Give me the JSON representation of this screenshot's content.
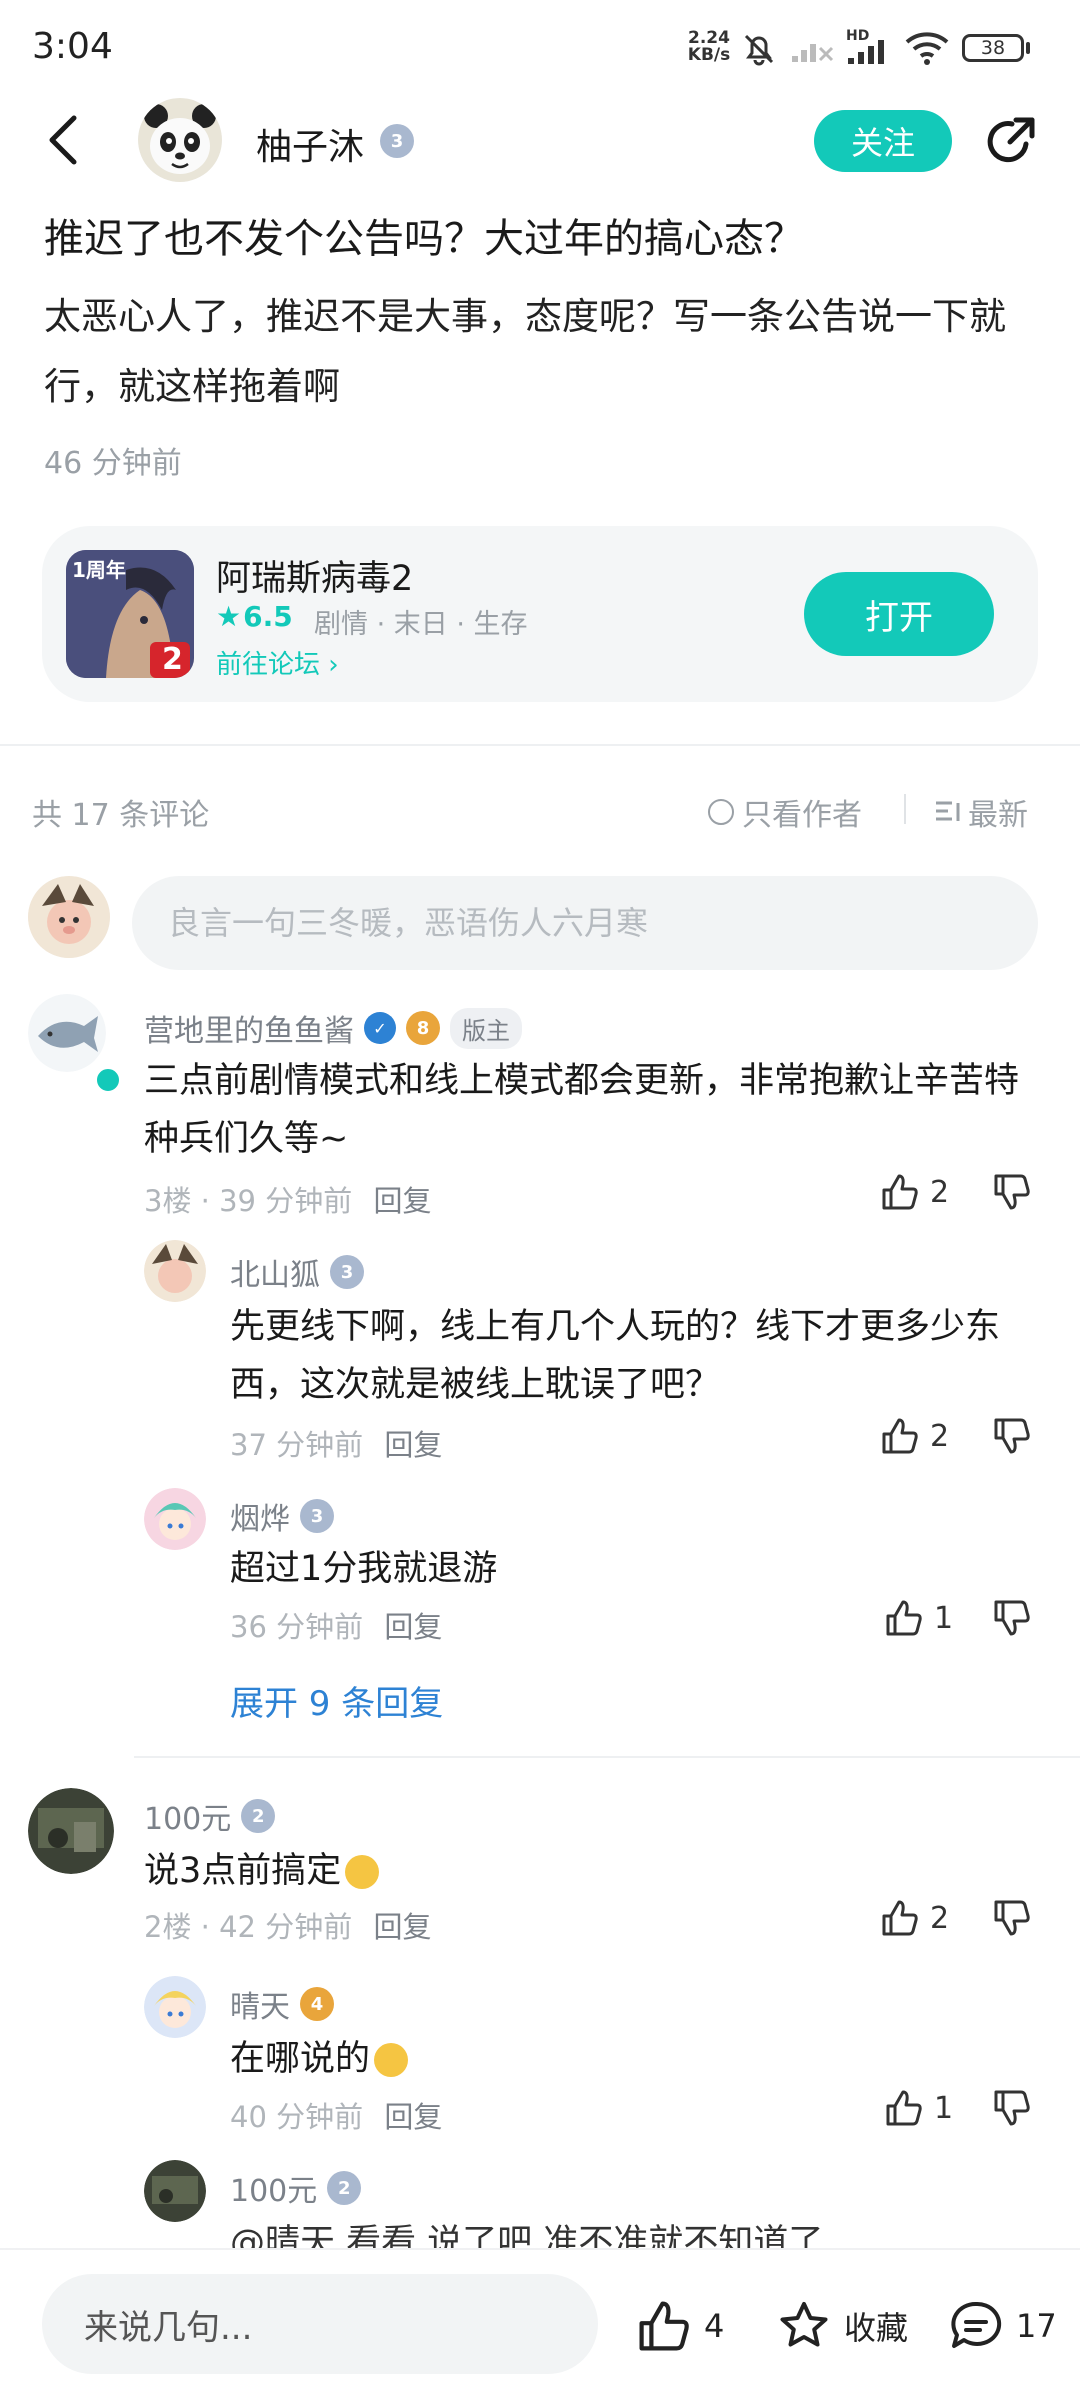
{
  "status_bar": {
    "time": "3:04",
    "net_speed_top": "2.24",
    "net_speed_bottom": "KB/s",
    "battery": "38",
    "hd": "HD"
  },
  "header": {
    "author": "柚子沐",
    "author_level": "3",
    "follow_label": "关注"
  },
  "post": {
    "title": "推迟了也不发个公告吗？大过年的搞心态？",
    "body": "太恶心人了，推迟不是大事，态度呢？写一条公告说一下就行，就这样拖着啊",
    "time": "46 分钟前"
  },
  "game_card": {
    "name": "阿瑞斯病毒2",
    "score": "6.5",
    "tags": "剧情 · 末日 · 生存",
    "forum_link": "前往论坛",
    "open_label": "打开",
    "icon_text": "1周年",
    "icon_num": "2"
  },
  "comments_header": {
    "count": "共 17 条评论",
    "only_author": "只看作者",
    "sort": "最新"
  },
  "comment_input": {
    "placeholder": "良言一句三冬暖，恶语伤人六月寒"
  },
  "comments": [
    {
      "user": "营地里的鱼鱼酱",
      "level": "8",
      "badge": "版主",
      "text": "三点前剧情模式和线上模式都会更新，非常抱歉让辛苦特种兵们久等~",
      "floor": "3楼",
      "time": "39 分钟前",
      "reply": "回复",
      "likes": "2",
      "replies": [
        {
          "user": "北山狐",
          "level": "3",
          "text": "先更线下啊，线上有几个人玩的？线下才更多少东西，这次就是被线上耽误了吧？",
          "time": "37 分钟前",
          "reply": "回复",
          "likes": "2"
        },
        {
          "user": "烟烨",
          "level": "3",
          "text": "超过1分我就退游",
          "time": "36 分钟前",
          "reply": "回复",
          "likes": "1"
        }
      ],
      "expand": "展开 9 条回复"
    },
    {
      "user": "100元",
      "level": "2",
      "text": "说3点前搞定",
      "floor": "2楼",
      "time": "42 分钟前",
      "reply": "回复",
      "likes": "2",
      "replies": [
        {
          "user": "晴天",
          "level": "4",
          "text": "在哪说的",
          "time": "40 分钟前",
          "reply": "回复",
          "likes": "1"
        },
        {
          "user": "100元",
          "level": "2",
          "text": "@晴天  看看 说了吧 准不准就不知道了"
        }
      ]
    }
  ],
  "bottom_bar": {
    "input_label": "来说几句...",
    "likes": "4",
    "favorite_label": "收藏",
    "comments": "17"
  },
  "colors": {
    "accent": "#13c9b9",
    "link": "#2d82d4",
    "muted": "#9aa0a6"
  }
}
